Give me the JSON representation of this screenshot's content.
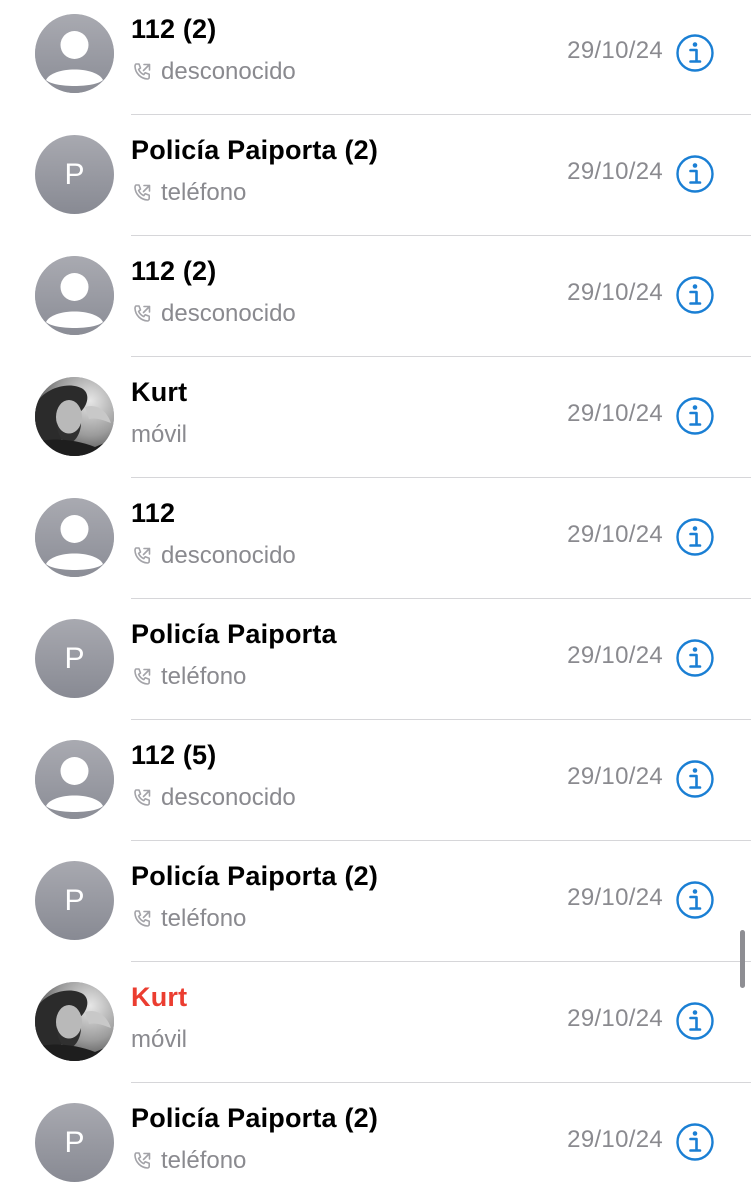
{
  "colors": {
    "accent": "#1a7fd4",
    "missed": "#eb3d30",
    "secondary_text": "#8a8a8f",
    "avatar_gray": "#9a9ba3"
  },
  "recents": [
    {
      "name": "112 (2)",
      "subtitle": "desconocido",
      "date": "29/10/24",
      "avatar": "person-silhouette",
      "show_call_icon": true,
      "missed": false
    },
    {
      "name": "Policía Paiporta (2)",
      "subtitle": "teléfono",
      "date": "29/10/24",
      "avatar": "initial",
      "initial": "P",
      "show_call_icon": true,
      "missed": false
    },
    {
      "name": "112 (2)",
      "subtitle": "desconocido",
      "date": "29/10/24",
      "avatar": "person-silhouette",
      "show_call_icon": true,
      "missed": false
    },
    {
      "name": "Kurt",
      "subtitle": "móvil",
      "date": "29/10/24",
      "avatar": "photo",
      "show_call_icon": false,
      "missed": false
    },
    {
      "name": "112",
      "subtitle": "desconocido",
      "date": "29/10/24",
      "avatar": "person-silhouette",
      "show_call_icon": true,
      "missed": false
    },
    {
      "name": "Policía Paiporta",
      "subtitle": "teléfono",
      "date": "29/10/24",
      "avatar": "initial",
      "initial": "P",
      "show_call_icon": true,
      "missed": false
    },
    {
      "name": "112 (5)",
      "subtitle": "desconocido",
      "date": "29/10/24",
      "avatar": "person-silhouette",
      "show_call_icon": true,
      "missed": false
    },
    {
      "name": "Policía Paiporta (2)",
      "subtitle": "teléfono",
      "date": "29/10/24",
      "avatar": "initial",
      "initial": "P",
      "show_call_icon": true,
      "missed": false
    },
    {
      "name": "Kurt",
      "subtitle": "móvil",
      "date": "29/10/24",
      "avatar": "photo",
      "show_call_icon": false,
      "missed": true
    },
    {
      "name": "Policía Paiporta (2)",
      "subtitle": "teléfono",
      "date": "29/10/24",
      "avatar": "initial",
      "initial": "P",
      "show_call_icon": true,
      "missed": false
    }
  ],
  "icons": {
    "info": "info-circle-icon",
    "call": "outgoing-call-icon",
    "silhouette": "person-silhouette-icon",
    "photo": "contact-photo"
  }
}
